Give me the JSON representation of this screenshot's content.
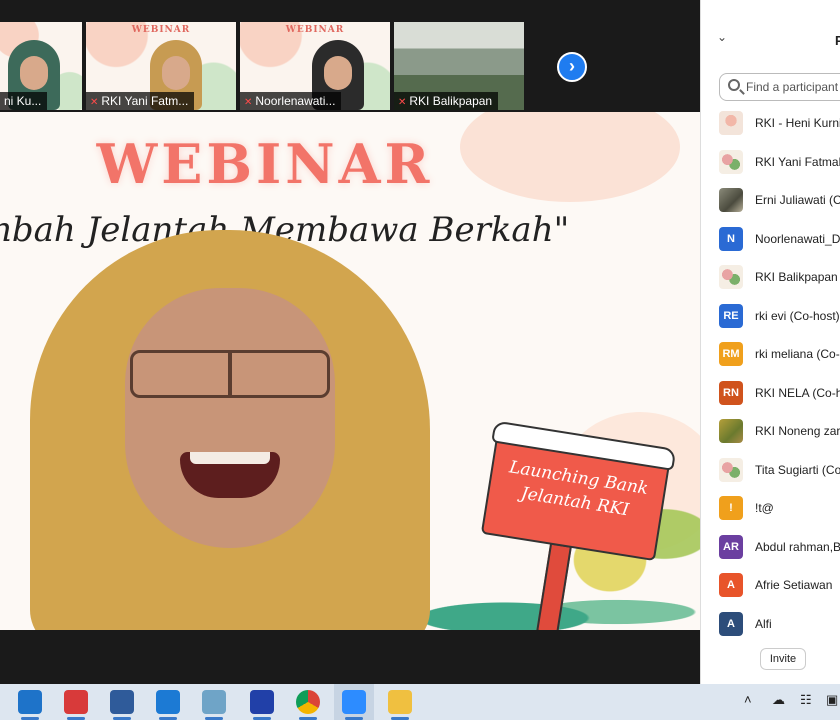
{
  "thumbnails": [
    {
      "label": "ni Ku..."
    },
    {
      "label": "RKI Yani Fatm...",
      "muted": true
    },
    {
      "label": "Noorlenawati...",
      "muted": true
    },
    {
      "label": "RKI Balikpapan",
      "muted": true
    }
  ],
  "next_page_icon": "chevron-right-icon",
  "main_video": {
    "banner_title": "WEBINAR",
    "banner_subtitle": "nbah  Jelantah  Membawa  Berkah\"",
    "sign_text": "Launching Bank Jelantah RKI"
  },
  "participants_panel": {
    "title": "P",
    "collapse_icon": "chevron-down-icon",
    "search_placeholder": "Find a participant",
    "participants": [
      {
        "name": "RKI - Heni Kurni",
        "avatar_type": "img-pink",
        "initials": ""
      },
      {
        "name": "RKI Yani Fatmah",
        "avatar_type": "img-leaf",
        "initials": ""
      },
      {
        "name": "Erni Juliawati (C",
        "avatar_type": "img-photo",
        "initials": ""
      },
      {
        "name": "Noorlenawati_D",
        "avatar_type": "initials",
        "initials": "N",
        "color": "#2a6ad4"
      },
      {
        "name": "RKI Balikpapan (",
        "avatar_type": "img-leaf",
        "initials": ""
      },
      {
        "name": "rki evi (Co-host)",
        "avatar_type": "initials",
        "initials": "RE",
        "color": "#2a6ad4"
      },
      {
        "name": "rki meliana (Co-",
        "avatar_type": "initials",
        "initials": "RM",
        "color": "#f0a01c"
      },
      {
        "name": "RKI NELA (Co-ho",
        "avatar_type": "initials",
        "initials": "RN",
        "color": "#d0531d"
      },
      {
        "name": "RKI Noneng zar",
        "avatar_type": "img-field",
        "initials": ""
      },
      {
        "name": "Tita Sugiarti (Co",
        "avatar_type": "img-leaf",
        "initials": ""
      },
      {
        "name": "!t@",
        "avatar_type": "initials",
        "initials": "!",
        "color": "#f0a01c"
      },
      {
        "name": "Abdul rahman,B",
        "avatar_type": "initials",
        "initials": "AR",
        "color": "#6b3fa0"
      },
      {
        "name": "Afrie Setiawan",
        "avatar_type": "initials",
        "initials": "A",
        "color": "#e8542a"
      },
      {
        "name": "Alfi",
        "avatar_type": "initials",
        "initials": "A",
        "color": "#2d4d7a"
      }
    ],
    "invite_label": "Invite"
  },
  "taskbar": {
    "apps": [
      {
        "name": "mail-icon",
        "color": "#1e73c9"
      },
      {
        "name": "gift-icon",
        "color": "#d83a3a"
      },
      {
        "name": "settings-icon",
        "color": "#2f5b9a"
      },
      {
        "name": "media-player-icon",
        "color": "#1c7ad4"
      },
      {
        "name": "notepad-icon",
        "color": "#6fa4c7"
      },
      {
        "name": "vpn-icon",
        "color": "#2140a8"
      },
      {
        "name": "chrome-icon",
        "color": "#e8b723"
      },
      {
        "name": "zoom-icon",
        "color": "#2d8cff",
        "active": true
      },
      {
        "name": "file-explorer-icon",
        "color": "#f0c040"
      }
    ],
    "tray": [
      "chevron-up-icon",
      "onedrive-icon",
      "network-icon",
      "display-icon"
    ]
  }
}
